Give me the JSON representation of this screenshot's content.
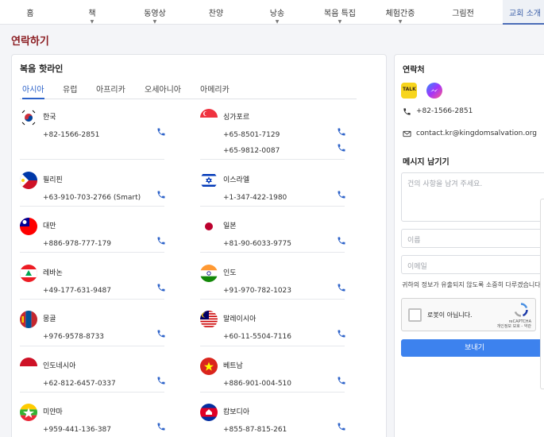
{
  "nav": {
    "items": [
      {
        "label": "홈",
        "caret": false
      },
      {
        "label": "책",
        "caret": true
      },
      {
        "label": "동영상",
        "caret": true
      },
      {
        "label": "찬양",
        "caret": false
      },
      {
        "label": "낭송",
        "caret": true
      },
      {
        "label": "복음 특집",
        "caret": true
      },
      {
        "label": "체험간증",
        "caret": true
      },
      {
        "label": "그림전",
        "caret": false
      },
      {
        "label": "교회 소개",
        "caret": false
      }
    ],
    "active_index": 8
  },
  "page_title": "연락하기",
  "hotline": {
    "title": "복음 핫라인",
    "tabs": [
      "아시아",
      "유럽",
      "아프리카",
      "오세아니아",
      "아메리카"
    ],
    "active_tab": 0,
    "entries": [
      {
        "country": "한국",
        "flag": "flag-korea",
        "phones": [
          "+82-1566-2851"
        ]
      },
      {
        "country": "싱가포르",
        "flag": "flag-singapore",
        "phones": [
          "+65-8501-7129",
          "+65-9812-0087"
        ]
      },
      {
        "country": "필리핀",
        "flag": "flag-philippines",
        "phones": [
          "+63-910-703-2766  (Smart)"
        ]
      },
      {
        "country": "이스라엘",
        "flag": "flag-israel",
        "phones": [
          "+1-347-422-1980"
        ]
      },
      {
        "country": "대만",
        "flag": "flag-taiwan",
        "phones": [
          "+886-978-777-179"
        ]
      },
      {
        "country": "일본",
        "flag": "flag-japan",
        "phones": [
          "+81-90-6033-9775"
        ]
      },
      {
        "country": "레바논",
        "flag": "flag-lebanon",
        "phones": [
          "+49-177-631-9487"
        ]
      },
      {
        "country": "인도",
        "flag": "flag-india",
        "phones": [
          "+91-970-782-1023"
        ]
      },
      {
        "country": "몽골",
        "flag": "flag-mongolia",
        "phones": [
          "+976-9578-8733"
        ]
      },
      {
        "country": "말레이시아",
        "flag": "flag-malaysia",
        "phones": [
          "+60-11-5504-7116"
        ]
      },
      {
        "country": "인도네시아",
        "flag": "flag-indonesia",
        "phones": [
          "+62-812-6457-0337"
        ]
      },
      {
        "country": "베트남",
        "flag": "flag-vietnam",
        "phones": [
          "+886-901-004-510"
        ]
      },
      {
        "country": "미얀마",
        "flag": "flag-myanmar",
        "phones": [
          "+959-441-136-387"
        ]
      },
      {
        "country": "캄보디아",
        "flag": "flag-cambodia",
        "phones": [
          "+855-87-815-261"
        ]
      }
    ]
  },
  "contact": {
    "title": "연락처",
    "phone": "+82-1566-2851",
    "email": "contact.kr@kingdomsalvation.org",
    "kakao_badge": "TALK"
  },
  "message": {
    "title": "메시지 남기기",
    "textarea_placeholder": "건의 사항을 남겨 주세요.",
    "name_placeholder": "이름",
    "email_placeholder": "이메일",
    "notice": "귀하의 정보가 유출되지 않도록 소중히 다루겠습니다.",
    "captcha_label": "로봇이 아닙니다.",
    "captcha_brand": "reCAPTCHA",
    "captcha_links": "개인정보 보호 - 약관",
    "submit_label": "보내기"
  },
  "colors": {
    "accent": "#2c62c9",
    "title_red": "#8b1d22",
    "submit_blue": "#3d82ee"
  }
}
